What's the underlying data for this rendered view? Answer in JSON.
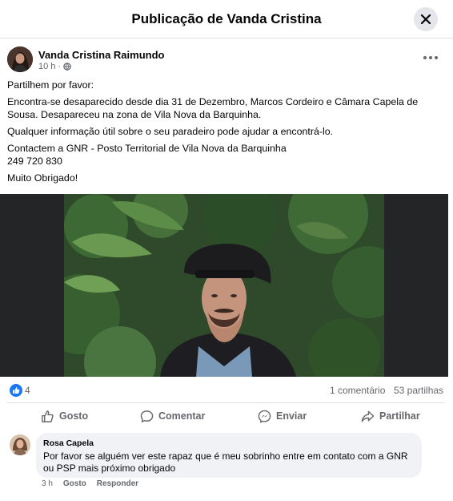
{
  "dialog": {
    "title": "Publicação de Vanda Cristina"
  },
  "post": {
    "author": "Vanda Cristina Raimundo",
    "time": "10 h",
    "body": [
      "Partilhem por favor:",
      "Encontra-se desaparecido desde dia 31 de Dezembro, Marcos Cordeiro e Câmara Capela de Sousa. Desapareceu na zona de Vila Nova da Barquinha.",
      "Qualquer informação útil sobre o seu paradeiro pode ajudar a encontrá-lo.",
      "Contactem a GNR - Posto Territorial de Vila Nova da Barquinha\n249 720 830",
      "Muito Obrigado!"
    ]
  },
  "stats": {
    "likes": "4",
    "comments": "1 comentário",
    "shares": "53 partilhas"
  },
  "actions": {
    "like": "Gosto",
    "comment": "Comentar",
    "send": "Enviar",
    "share": "Partilhar"
  },
  "comment": {
    "author": "Rosa Capela",
    "text": "Por favor se alguém ver este rapaz que é meu sobrinho entre em contato com a GNR ou PSP mais próximo obrigado",
    "time": "3 h",
    "like": "Gosto",
    "reply": "Responder"
  },
  "colors": {
    "accent": "#1877f2",
    "secondary_text": "#65676b",
    "bubble": "#f0f2f5"
  },
  "icons": [
    "close-icon",
    "globe-icon",
    "more-icon",
    "like-icon",
    "comment-icon",
    "messenger-icon",
    "share-icon"
  ]
}
